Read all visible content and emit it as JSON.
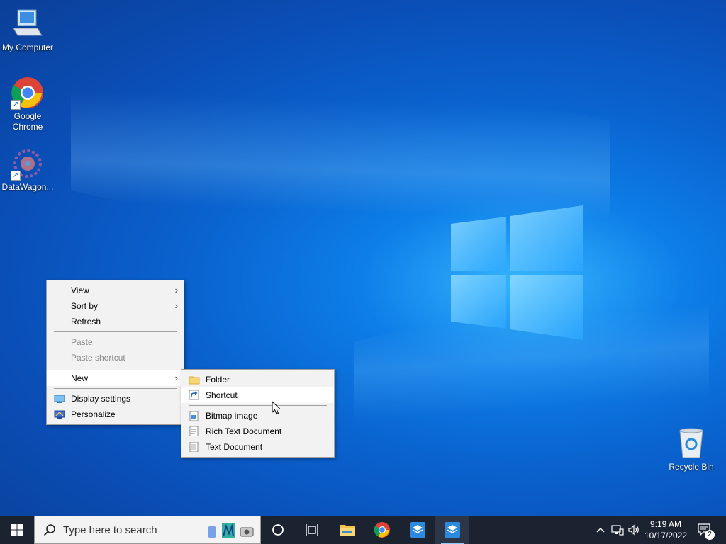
{
  "desktop": {
    "icons": [
      {
        "label": "My Computer"
      },
      {
        "label": "Google Chrome"
      },
      {
        "label": "DataWagon..."
      },
      {
        "label": "Recycle Bin"
      }
    ]
  },
  "context_menu": {
    "items": [
      {
        "label": "View",
        "has_submenu": true
      },
      {
        "label": "Sort by",
        "has_submenu": true
      },
      {
        "label": "Refresh"
      },
      {
        "label": "Paste",
        "disabled": true
      },
      {
        "label": "Paste shortcut",
        "disabled": true
      },
      {
        "label": "New",
        "has_submenu": true,
        "active": true
      },
      {
        "label": "Display settings",
        "icon": "display-icon"
      },
      {
        "label": "Personalize",
        "icon": "personalize-icon"
      }
    ]
  },
  "new_submenu": {
    "items": [
      {
        "label": "Folder",
        "icon": "folder-icon"
      },
      {
        "label": "Shortcut",
        "icon": "shortcut-icon",
        "hovered": true
      },
      {
        "label": "Bitmap image",
        "icon": "bitmap-icon"
      },
      {
        "label": "Rich Text Document",
        "icon": "rtf-icon"
      },
      {
        "label": "Text Document",
        "icon": "text-doc-icon"
      }
    ]
  },
  "taskbar": {
    "search_placeholder": "Type here to search",
    "clock_time": "9:19 AM",
    "clock_date": "10/17/2022",
    "notification_count": "2"
  },
  "colors": {
    "taskbar_bg": "#1b2330",
    "menu_bg": "#f2f2f2",
    "desktop_accent": "#0a63cf"
  }
}
